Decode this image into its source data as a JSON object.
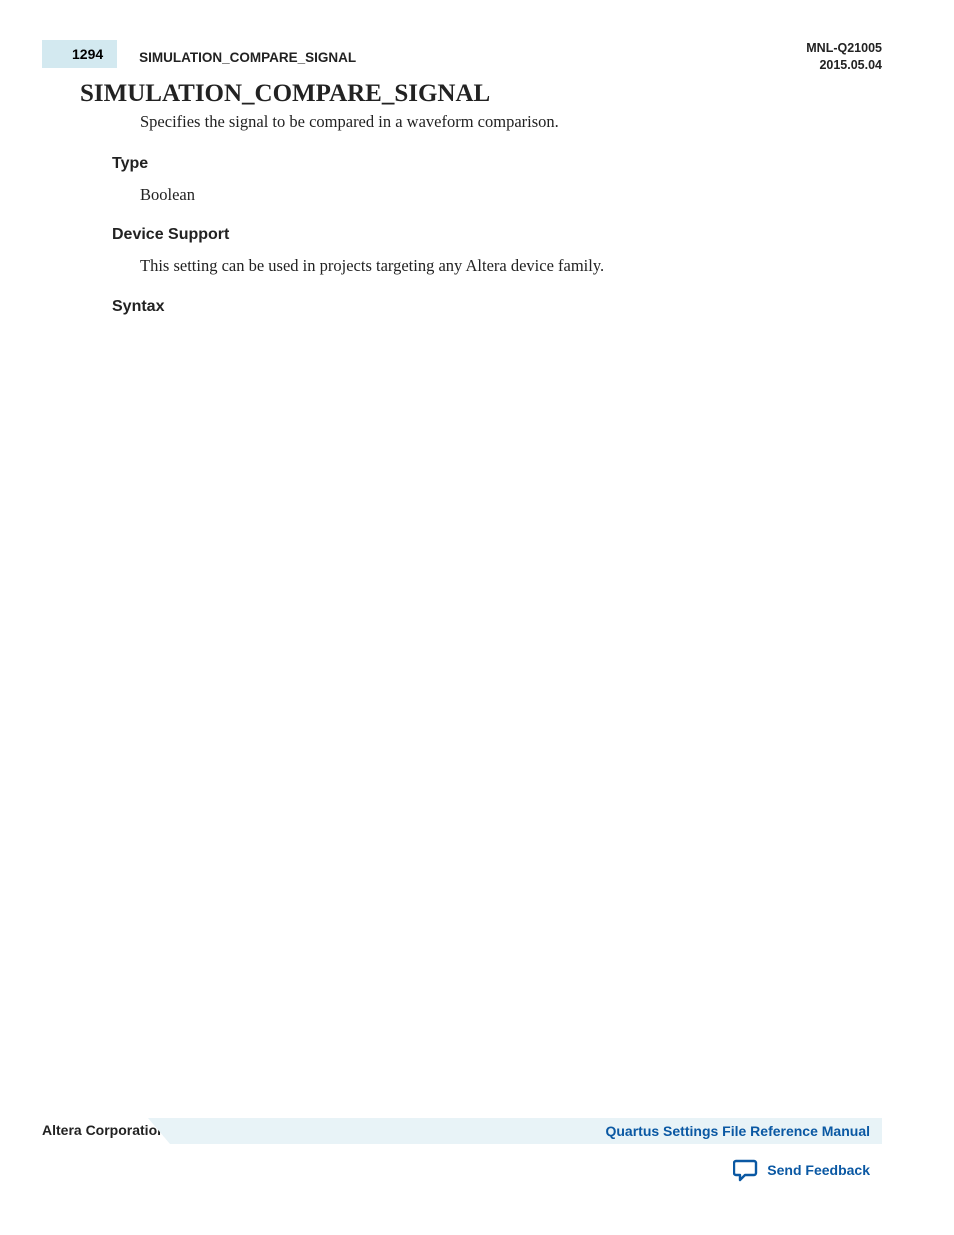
{
  "header": {
    "page_number": "1294",
    "section_title": "SIMULATION_COMPARE_SIGNAL",
    "doc_id": "MNL-Q21005",
    "date": "2015.05.04"
  },
  "content": {
    "heading": "SIMULATION_COMPARE_SIGNAL",
    "description": "Specifies the signal to be compared in a waveform comparison.",
    "type_label": "Type",
    "type_value": "Boolean",
    "device_support_label": "Device Support",
    "device_support_value": "This setting can be used in projects targeting any Altera device family.",
    "syntax_label": "Syntax"
  },
  "footer": {
    "company": "Altera Corporation",
    "manual_link": "Quartus Settings File Reference Manual",
    "feedback": "Send Feedback"
  }
}
